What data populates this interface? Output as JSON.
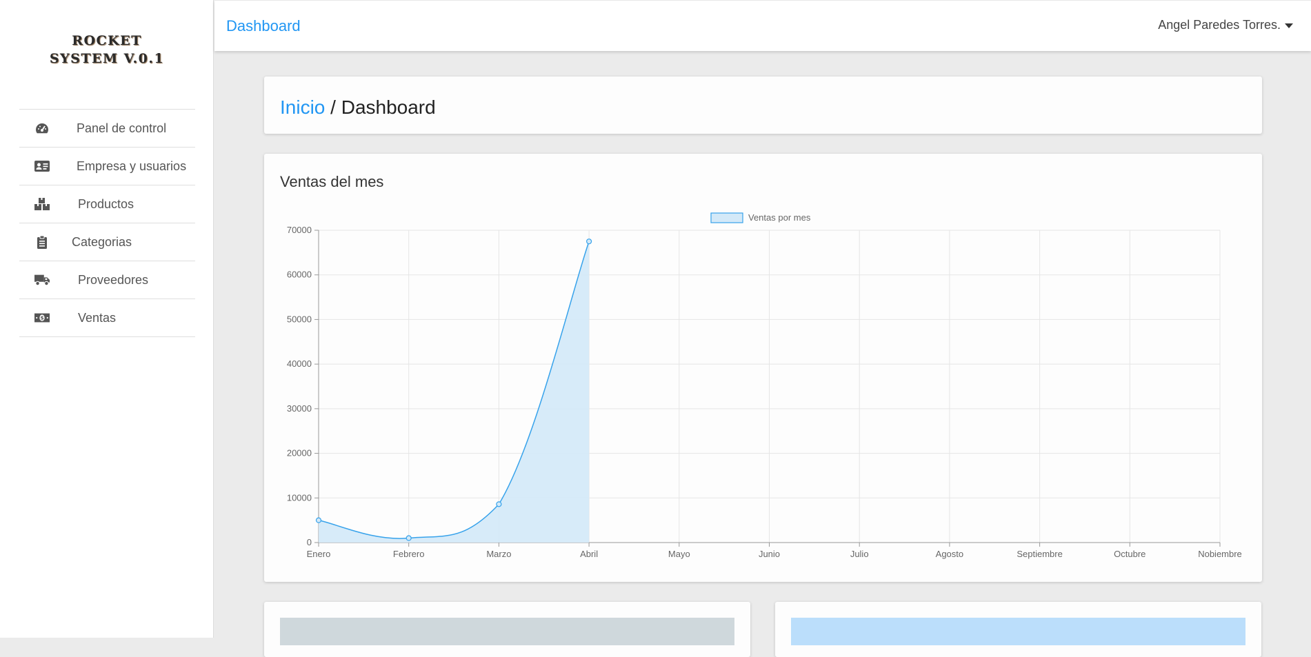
{
  "sidebar": {
    "logo_line1": "ROCKET",
    "logo_line2": "SYSTEM V.0.1",
    "items": [
      {
        "label": "Panel de control",
        "icon": "dashboard-gauge-icon"
      },
      {
        "label": "Empresa y usuarios",
        "icon": "id-card-icon"
      },
      {
        "label": "Productos",
        "icon": "boxes-icon"
      },
      {
        "label": "Categorias",
        "icon": "clipboard-list-icon"
      },
      {
        "label": "Proveedores",
        "icon": "truck-icon"
      },
      {
        "label": "Ventas",
        "icon": "money-bill-icon"
      }
    ]
  },
  "header": {
    "title": "Dashboard",
    "user": "Angel Paredes Torres."
  },
  "breadcrumb": {
    "home": "Inicio",
    "separator": " / ",
    "current": "Dashboard"
  },
  "chart_card": {
    "title": "Ventas del mes"
  },
  "chart_data": {
    "type": "line",
    "categories": [
      "Enero",
      "Febrero",
      "Marzo",
      "Abril",
      "Mayo",
      "Junio",
      "Julio",
      "Agosto",
      "Septiembre",
      "Octubre",
      "Nobiembre"
    ],
    "series": [
      {
        "name": "Ventas por mes",
        "values": [
          5000,
          1000,
          8600,
          67500
        ],
        "fill": true
      }
    ],
    "yticks": [
      0,
      10000,
      20000,
      30000,
      40000,
      50000,
      60000,
      70000
    ],
    "ylim": [
      0,
      70000
    ],
    "grid": true,
    "legend": "top-center",
    "colors": {
      "line": "#36a2eb",
      "fill": "#d3e9f8",
      "grid": "#e5e5e5",
      "axis": "#999999"
    }
  },
  "tables": {
    "left_header_color": "#cfd8dc",
    "right_header_color": "#bbdefb"
  }
}
